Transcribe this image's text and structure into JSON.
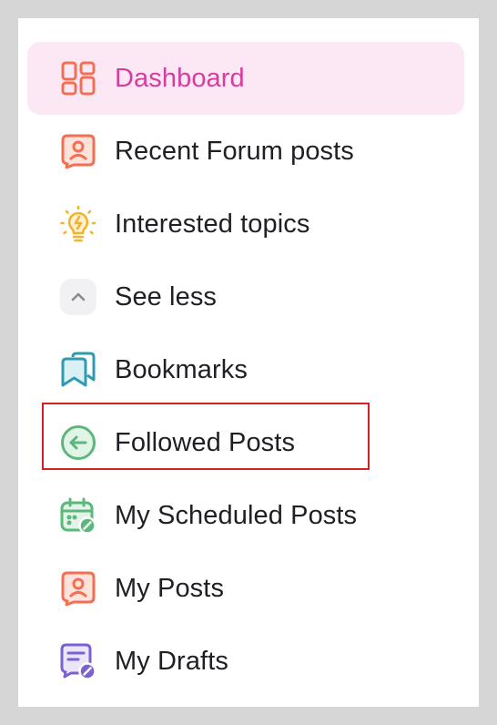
{
  "sidebar": {
    "items": [
      {
        "label": "Dashboard",
        "icon": "dashboard-grid-icon",
        "active": true,
        "color": "#f26f54"
      },
      {
        "label": "Recent Forum posts",
        "icon": "user-chat-icon",
        "color": "#f26f54"
      },
      {
        "label": "Interested topics",
        "icon": "lightbulb-icon",
        "color": "#f2b42c"
      },
      {
        "label": "See less",
        "icon": "chevron-up-icon",
        "color": "#8a8a8a"
      },
      {
        "label": "Bookmarks",
        "icon": "bookmarks-icon",
        "color": "#2e9bb3"
      },
      {
        "label": "Followed Posts",
        "icon": "arrow-left-circle-icon",
        "color": "#5cb87a",
        "highlighted": true
      },
      {
        "label": "My Scheduled Posts",
        "icon": "calendar-edit-icon",
        "color": "#5cb87a"
      },
      {
        "label": "My Posts",
        "icon": "user-chat-icon",
        "color": "#f26f54"
      },
      {
        "label": "My Drafts",
        "icon": "draft-edit-icon",
        "color": "#7b61d1"
      }
    ]
  },
  "colors": {
    "active_bg": "#fce8f4",
    "active_text": "#d53d9f",
    "text": "#1f1f24",
    "highlight_border": "#d81f26"
  }
}
